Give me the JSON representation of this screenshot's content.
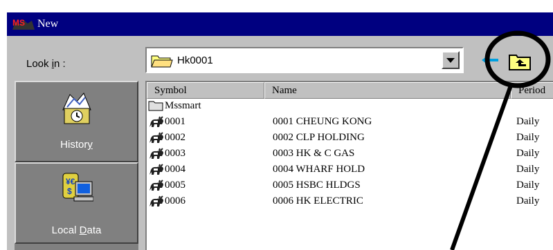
{
  "window": {
    "title": "New",
    "logo_text": "MS"
  },
  "look_in": {
    "label_pre": "Look ",
    "label_accel": "i",
    "label_post": "n :",
    "value": "Hk0001"
  },
  "places": [
    {
      "label_pre": "Histor",
      "label_accel": "y",
      "label_post": "",
      "icon": "history-icon"
    },
    {
      "label_pre": "Local ",
      "label_accel": "D",
      "label_post": "ata",
      "icon": "local-data-icon"
    }
  ],
  "columns": [
    "Symbol",
    "Name",
    "Period"
  ],
  "files": [
    {
      "symbol": "Mssmart",
      "name": "",
      "period": "",
      "icon": "folder-icon"
    },
    {
      "symbol": "0001",
      "name": "0001 CHEUNG KONG",
      "period": "Daily",
      "icon": "bull-icon"
    },
    {
      "symbol": "0002",
      "name": "0002 CLP HOLDING",
      "period": "Daily",
      "icon": "bull-icon"
    },
    {
      "symbol": "0003",
      "name": "0003 HK & C GAS",
      "period": "Daily",
      "icon": "bull-icon"
    },
    {
      "symbol": "0004",
      "name": "0004 WHARF HOLD",
      "period": "Daily",
      "icon": "bull-icon"
    },
    {
      "symbol": "0005",
      "name": "0005 HSBC HLDGS",
      "period": "Daily",
      "icon": "bull-icon"
    },
    {
      "symbol": "0006",
      "name": "0006 HK ELECTRIC",
      "period": "Daily",
      "icon": "bull-icon"
    }
  ],
  "colors": {
    "titlebar": "#000080",
    "dialog": "#c0c0c0",
    "places_panel": "#808080",
    "back_arrow": "#00a0e0",
    "annotation": "#000000"
  }
}
